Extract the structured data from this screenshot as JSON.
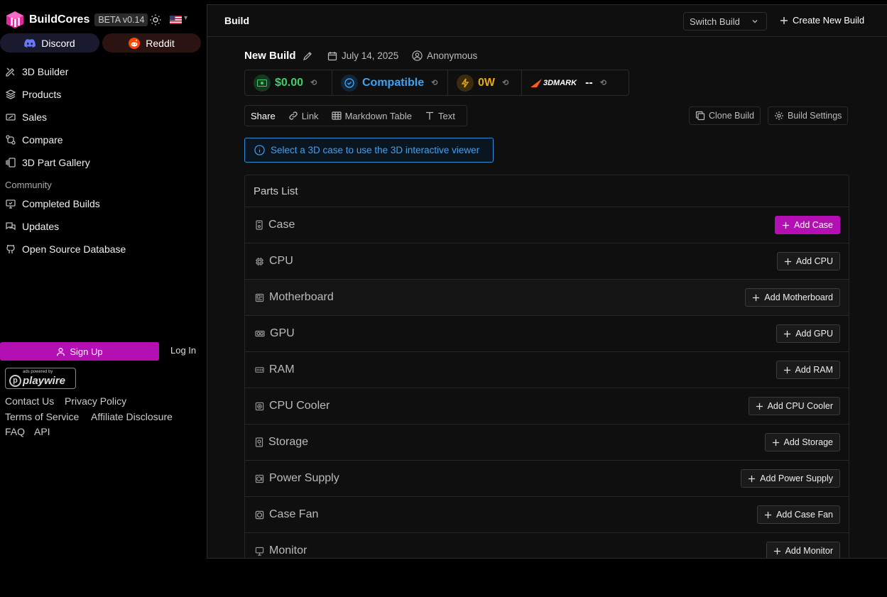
{
  "brand": {
    "name": "BuildCores",
    "version": "BETA v0.14"
  },
  "social": {
    "discord": "Discord",
    "reddit": "Reddit"
  },
  "nav": {
    "items": [
      "3D Builder",
      "Products",
      "Sales",
      "Compare",
      "3D Part Gallery"
    ],
    "community_label": "Community",
    "community_items": [
      "Completed Builds",
      "Updates",
      "Open Source Database"
    ]
  },
  "auth": {
    "signup": "Sign Up",
    "login": "Log In"
  },
  "ad": {
    "small": "ads powered by",
    "big": "playwire"
  },
  "footer": {
    "links": [
      "Contact Us",
      "Privacy Policy",
      "Terms of Service",
      "Affiliate Disclosure",
      "FAQ",
      "API"
    ]
  },
  "topbar": {
    "title": "Build",
    "switch_label": "Switch Build",
    "create_label": "Create New Build"
  },
  "build": {
    "title": "New Build",
    "date": "July 14, 2025",
    "author": "Anonymous"
  },
  "stats": {
    "price": "$0.00",
    "compat": "Compatible",
    "power": "0W",
    "benchmark_brand": "3DMARK",
    "benchmark_value": "--"
  },
  "share": {
    "label": "Share",
    "options": [
      "Link",
      "Markdown Table",
      "Text"
    ]
  },
  "actions": {
    "clone": "Clone Build",
    "settings": "Build Settings"
  },
  "info_text": "Select a 3D case to use the 3D interactive viewer",
  "parts": {
    "title": "Parts List",
    "rows": [
      {
        "name": "Case",
        "button": "Add Case"
      },
      {
        "name": "CPU",
        "button": "Add CPU"
      },
      {
        "name": "Motherboard",
        "button": "Add Motherboard"
      },
      {
        "name": "GPU",
        "button": "Add GPU"
      },
      {
        "name": "RAM",
        "button": "Add RAM"
      },
      {
        "name": "CPU Cooler",
        "button": "Add CPU Cooler"
      },
      {
        "name": "Storage",
        "button": "Add Storage"
      },
      {
        "name": "Power Supply",
        "button": "Add Power Supply"
      },
      {
        "name": "Case Fan",
        "button": "Add Case Fan"
      },
      {
        "name": "Monitor",
        "button": "Add Monitor"
      }
    ]
  },
  "colors": {
    "accent": "#b30fb3",
    "price": "#3fcf6a",
    "compat": "#3fa1f0",
    "power": "#e6a817",
    "info": "#3fa1f0"
  }
}
